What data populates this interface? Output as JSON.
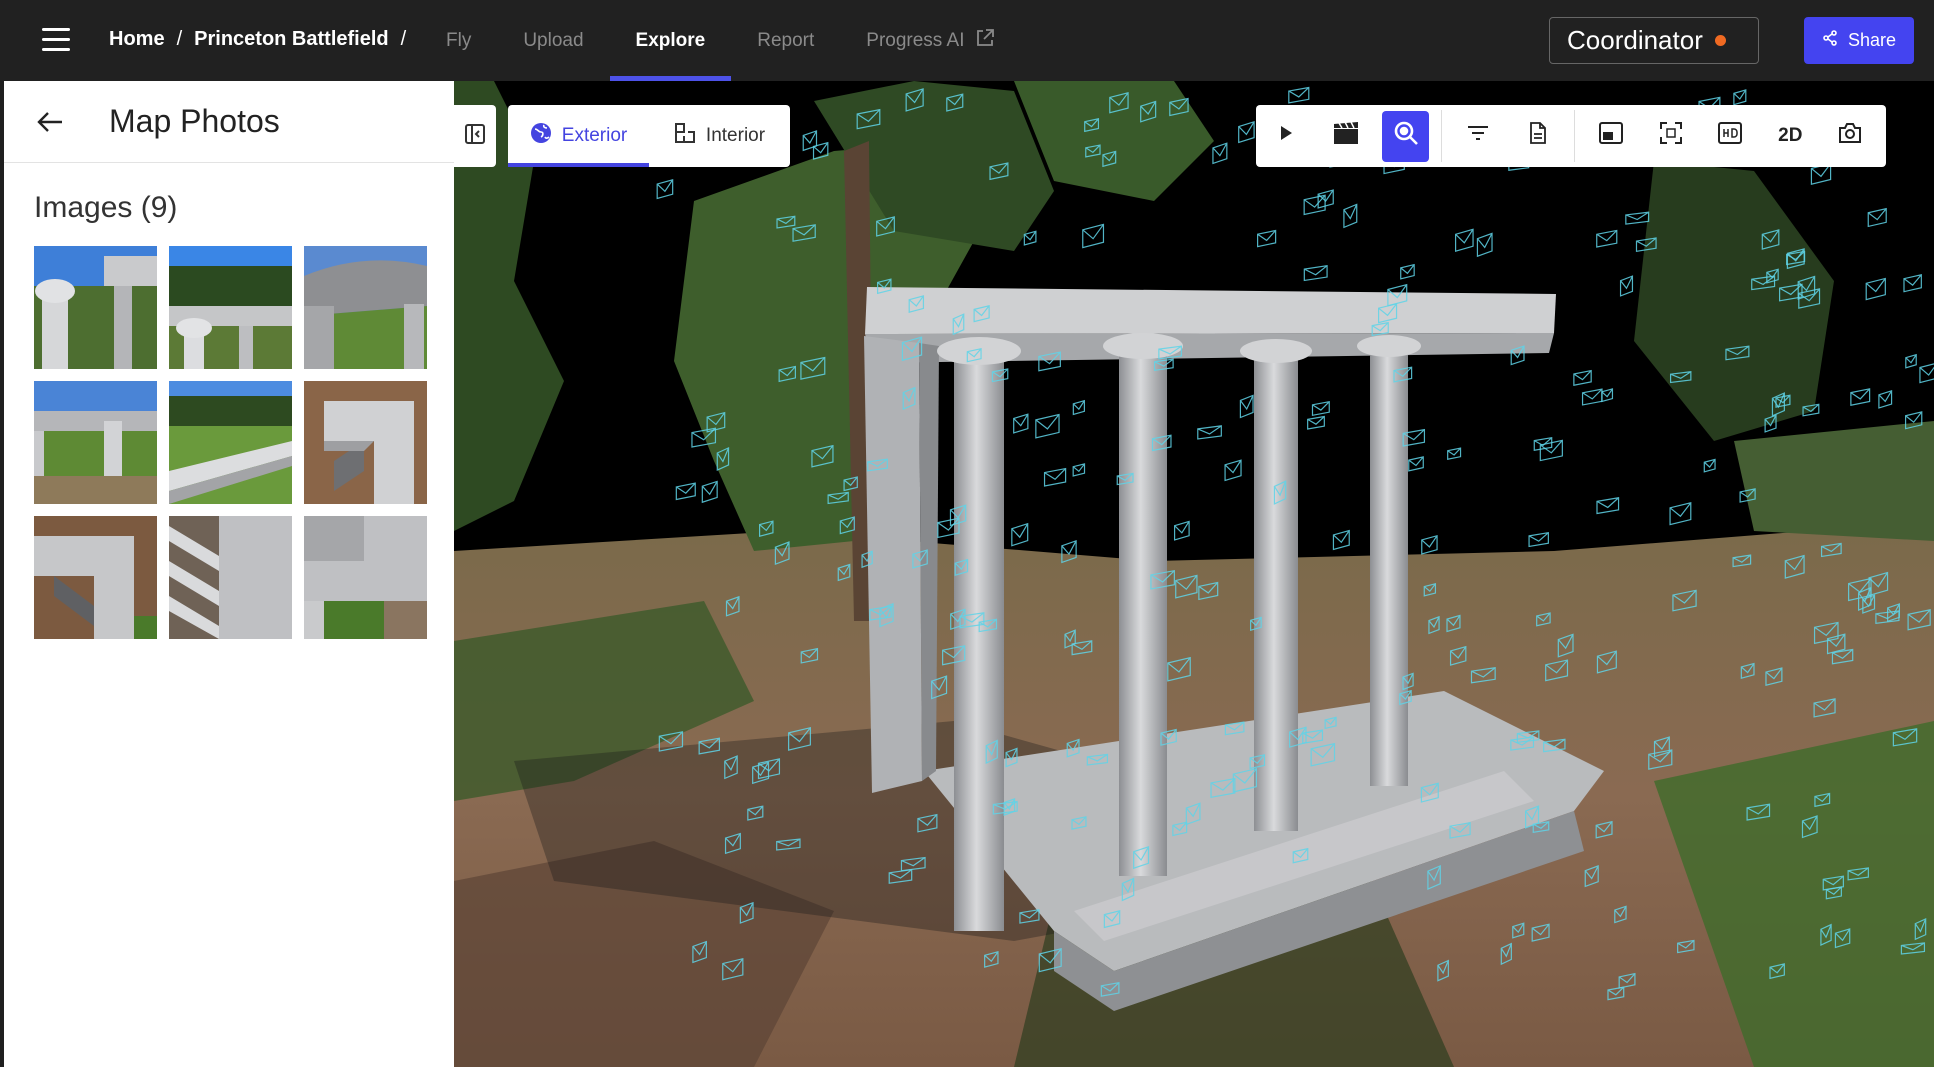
{
  "header": {
    "breadcrumb": {
      "home": "Home",
      "sep1": "/",
      "project": "Princeton Battlefield",
      "sep2": "/"
    },
    "tabs": [
      {
        "label": "Fly",
        "active": false
      },
      {
        "label": "Upload",
        "active": false
      },
      {
        "label": "Explore",
        "active": true
      },
      {
        "label": "Report",
        "active": false
      },
      {
        "label": "Progress AI",
        "active": false,
        "external": true
      }
    ],
    "role": {
      "label": "Coordinator",
      "status_color": "#f06a22"
    },
    "share_label": "Share"
  },
  "panel": {
    "title": "Map Photos",
    "images_heading": "Images (9)",
    "thumbnails": [
      {
        "name": "photo-1",
        "subject": "column capital with sky"
      },
      {
        "name": "photo-2",
        "subject": "columns with trees"
      },
      {
        "name": "photo-3",
        "subject": "entablature and lawn"
      },
      {
        "name": "photo-4",
        "subject": "column and lawn"
      },
      {
        "name": "photo-5",
        "subject": "stylobate and field"
      },
      {
        "name": "photo-6",
        "subject": "aerial corner"
      },
      {
        "name": "photo-7",
        "subject": "aerial roof edge"
      },
      {
        "name": "photo-8",
        "subject": "aerial roof beams"
      },
      {
        "name": "photo-9",
        "subject": "aerial roof top"
      }
    ]
  },
  "viewer": {
    "mode_toggle": [
      {
        "label": "Exterior",
        "icon": "globe-icon",
        "active": true
      },
      {
        "label": "Interior",
        "icon": "floorplan-icon",
        "active": false
      }
    ],
    "toolbar": [
      {
        "name": "play",
        "icon": "play-icon",
        "active": false
      },
      {
        "name": "video",
        "icon": "clapperboard-icon",
        "active": false
      },
      {
        "name": "zoom-photos",
        "icon": "magnify-icon",
        "active": true
      },
      {
        "name": "filter",
        "icon": "filter-icon",
        "active": false
      },
      {
        "name": "report",
        "icon": "document-icon",
        "active": false
      },
      {
        "name": "picture-in-picture",
        "icon": "pip-icon",
        "active": false
      },
      {
        "name": "fullscreen",
        "icon": "fullscreen-icon",
        "active": false
      },
      {
        "name": "hd",
        "icon": "hd-icon",
        "active": false
      },
      {
        "name": "view-2d",
        "label": "2D",
        "active": false
      },
      {
        "name": "screenshot",
        "icon": "camera-icon",
        "active": false
      }
    ],
    "accent_color": "#4444f0",
    "camera_marker_color": "#5fd3e8"
  }
}
